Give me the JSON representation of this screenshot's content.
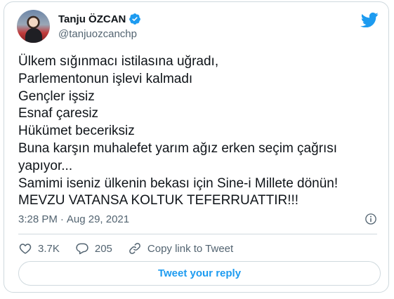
{
  "author": {
    "name": "Tanju ÖZCAN",
    "handle": "@tanjuozcanchp",
    "verified_icon": "verified-badge-icon",
    "avatar": "profile-photo"
  },
  "brand": {
    "icon": "twitter-bird-icon",
    "color": "#1d9bf0"
  },
  "tweet": {
    "lines": [
      "Ülkem sığınmacı istilasına uğradı,",
      "Parlementonun işlevi kalmadı",
      "Gençler işsiz",
      "Esnaf çaresiz",
      "Hükümet beceriksiz",
      "Buna karşın muhalefet yarım ağız erken seçim çağrısı",
      "yapıyor...",
      "Samimi iseniz ülkenin bekası için Sine-i Millete dönün!",
      "MEVZU VATANSA KOLTUK TEFERRUATTIR!!!"
    ]
  },
  "meta": {
    "time": "3:28 PM",
    "separator": "·",
    "date": "Aug 29, 2021",
    "info_icon": "info-icon"
  },
  "actions": {
    "likes": "3.7K",
    "replies": "205",
    "copy_link": "Copy link to Tweet"
  },
  "reply_button": "Tweet your reply",
  "colors": {
    "text": "#0f1419",
    "secondary": "#536471",
    "border": "#cfd9de",
    "accent": "#1d9bf0"
  }
}
